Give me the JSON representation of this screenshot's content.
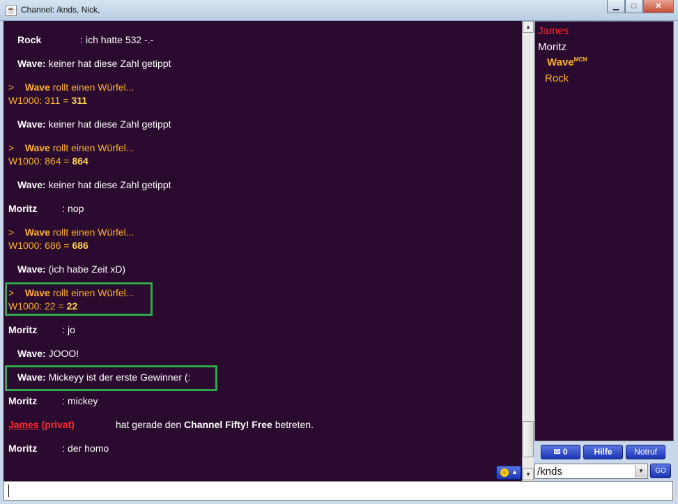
{
  "window": {
    "title": "Channel: /knds,  Nick,",
    "controls": {
      "minimize": "▁",
      "maximize": "□",
      "close": "✕"
    }
  },
  "chat": {
    "messages": [
      {
        "nick": "Rock",
        "text": ": ich hatte 532 -.-"
      },
      {
        "nick": "Wave:",
        "text": " keiner hat diese Zahl getippt"
      },
      {
        "prefix": ">",
        "nick": "Wave",
        "action": " rollt einen Würfel...",
        "roll": "W1000: 311 = ",
        "result": "311"
      },
      {
        "nick": "Wave:",
        "text": " keiner hat diese Zahl getippt"
      },
      {
        "prefix": ">",
        "nick": "Wave",
        "action": " rollt einen Würfel...",
        "roll": "W1000: 864 = ",
        "result": "864"
      },
      {
        "nick": "Wave:",
        "text": " keiner hat diese Zahl getippt"
      },
      {
        "nick": "Moritz",
        "text": ": nop"
      },
      {
        "prefix": ">",
        "nick": "Wave",
        "action": " rollt einen Würfel...",
        "roll": "W1000: 686 = ",
        "result": "686"
      },
      {
        "nick": "Wave:",
        "text": " (ich habe Zeit xD)"
      },
      {
        "prefix": ">",
        "nick": "Wave",
        "action": " rollt einen Würfel...",
        "roll": "W1000: 22 = ",
        "result": "22"
      },
      {
        "nick": "Moritz",
        "text": ": jo"
      },
      {
        "nick": "Wave:",
        "text": " JOOO!"
      },
      {
        "nick": "Wave:",
        "text": " Mickeyy ist der erste Gewinner (:"
      },
      {
        "nick": "Moritz",
        "text": ": mickey"
      },
      {
        "nick": "James",
        "private": "(privat)",
        "text_before": "hat gerade den ",
        "channel": "Channel Fifty! Free",
        "text_after": " betreten."
      },
      {
        "nick": "Moritz",
        "text": ": der homo"
      }
    ]
  },
  "userlist": {
    "users": [
      {
        "name": "James",
        "color": "#ff2a2a"
      },
      {
        "name": "Moritz",
        "color": "#ffffff"
      },
      {
        "name": "Wave",
        "badge": "MCM",
        "color": "#ffb228"
      },
      {
        "name": "Rock",
        "color": "#ffb228"
      }
    ]
  },
  "buttons": {
    "mail_count": "0",
    "mail_icon": "envelope-icon",
    "help": "Hilfe",
    "emergency": "Notruf",
    "go": "GO"
  },
  "channel_select": {
    "value": "/knds"
  },
  "input": {
    "value": ""
  },
  "colors": {
    "background": "#2a0a2e",
    "roll": "#ffb228",
    "highlight": "#2ea84a",
    "private": "#ff2a2a"
  }
}
